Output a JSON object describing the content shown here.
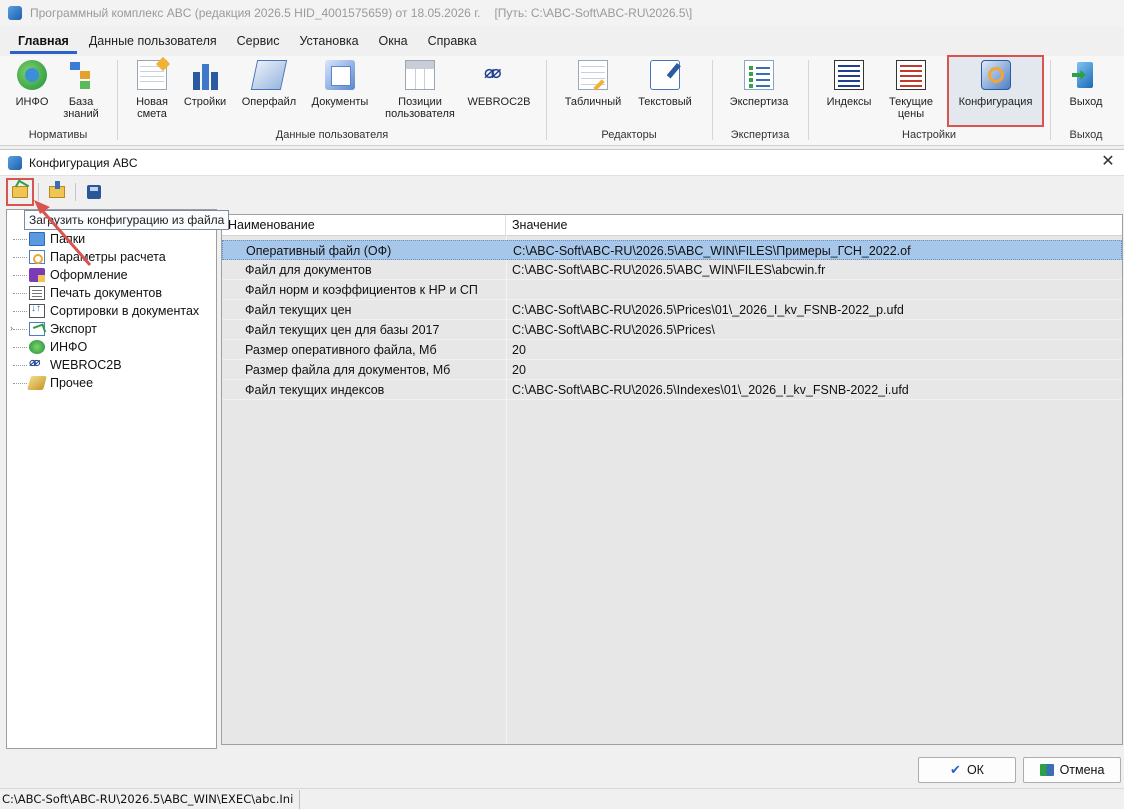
{
  "window": {
    "title": "Программный комплекс ABC (редакция 2026.5 HID_4001575659) от 18.05.2026 г.",
    "path": "[Путь: C:\\ABC-Soft\\ABC-RU\\2026.5\\]"
  },
  "menu_tabs": [
    "Главная",
    "Данные пользователя",
    "Сервис",
    "Установка",
    "Окна",
    "Справка"
  ],
  "ribbon": {
    "groups": {
      "normatives": "Нормативы",
      "user_data": "Данные пользователя",
      "editors": "Редакторы",
      "expertise": "Экспертиза",
      "settings": "Настройки",
      "exit": "Выход"
    },
    "buttons": {
      "info": "ИНФО",
      "knowledge_base": "База знаний",
      "new_estimate": "Новая смета",
      "constructions": "Стройки",
      "operfile": "Оперфайл",
      "documents": "Документы",
      "user_positions": "Позиции пользователя",
      "webroc2b": "WEBROC2B",
      "tabular": "Табличный",
      "text": "Текстовый",
      "expertise": "Экспертиза",
      "indexes": "Индексы",
      "current_prices": "Текущие цены",
      "configuration": "Конфигурация",
      "exit": "Выход"
    }
  },
  "dialog": {
    "title": "Конфигурация ABC",
    "tooltip": "Загрузить конфигурацию из файла",
    "tree": [
      "Папки",
      "Параметры расчета",
      "Оформление",
      "Печать документов",
      "Сортировки в документах",
      "Экспорт",
      "ИНФО",
      "WEBROC2B",
      "Прочее"
    ],
    "grid": {
      "headers": [
        "Наименование",
        "Значение"
      ],
      "rows": [
        [
          "Оперативный файл (ОФ)",
          "C:\\ABC-Soft\\ABC-RU\\2026.5\\ABC_WIN\\FILES\\Примеры_ГСН_2022.of"
        ],
        [
          "Файл для документов",
          "C:\\ABC-Soft\\ABC-RU\\2026.5\\ABC_WIN\\FILES\\abcwin.fr"
        ],
        [
          "Файл норм и коэффициентов к НР и СП",
          ""
        ],
        [
          "Файл текущих цен",
          "C:\\ABC-Soft\\ABC-RU\\2026.5\\Prices\\01\\_2026_I_kv_FSNB-2022_p.ufd"
        ],
        [
          "Файл текущих цен для базы 2017",
          "C:\\ABC-Soft\\ABC-RU\\2026.5\\Prices\\"
        ],
        [
          "Размер оперативного файла, Мб",
          "20"
        ],
        [
          "Размер файла для документов, Мб",
          "20"
        ],
        [
          "Файл текущих индексов",
          "C:\\ABC-Soft\\ABC-RU\\2026.5\\Indexes\\01\\_2026_I_kv_FSNB-2022_i.ufd"
        ]
      ]
    },
    "ok": "ОК",
    "cancel": "Отмена"
  },
  "status": {
    "path": "C:\\ABC-Soft\\ABC-RU\\2026.5\\ABC_WIN\\EXEC\\abc.Ini"
  },
  "colors": {
    "accent": "#2a62c9",
    "highlight": "#d9534f",
    "selection": "#a7c7ea"
  }
}
